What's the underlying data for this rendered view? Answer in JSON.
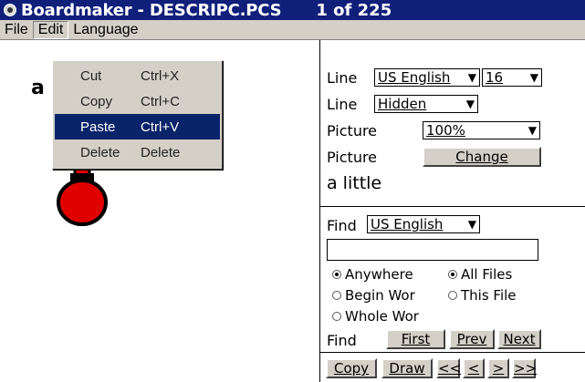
{
  "window": {
    "title": "Boardmaker - DESCRIPC.PCS",
    "page_counter": "1 of 225"
  },
  "menubar": {
    "items": [
      "File",
      "Edit",
      "Language"
    ]
  },
  "edit_menu": {
    "items": [
      {
        "label": "Cut",
        "shortcut": "Ctrl+X"
      },
      {
        "label": "Copy",
        "shortcut": "Ctrl+C"
      },
      {
        "label": "Paste",
        "shortcut": "Ctrl+V"
      },
      {
        "label": "Delete",
        "shortcut": "Delete"
      }
    ],
    "selected": "Paste"
  },
  "symbol": {
    "letter": "a",
    "caption": "a little"
  },
  "settings": {
    "line1_label": "Line",
    "language_value": "US English",
    "font_size_value": "16",
    "line2_label": "Line",
    "line_style_value": "Hidden",
    "picture1_label": "Picture",
    "zoom_value": "100%",
    "picture2_label": "Picture",
    "change_button": "Change"
  },
  "find": {
    "label": "Find",
    "language_value": "US English",
    "query_value": "",
    "options": {
      "anywhere": "Anywhere",
      "begin_word": "Begin Wor",
      "whole_word": "Whole Wor",
      "all_files": "All Files",
      "this_file": "This File"
    },
    "nav_label": "Find",
    "first_button": "First",
    "prev_button": "Prev",
    "next_button": "Next"
  },
  "bottom_toolbar": {
    "copy": "Copy",
    "draw": "Draw",
    "first": "<<",
    "prev": "<",
    "next": ">",
    "last": ">>"
  },
  "colors": {
    "title_bar": "#0f1f7a",
    "menu_highlight": "#0a246a",
    "thermometer_red": "#e00000"
  }
}
